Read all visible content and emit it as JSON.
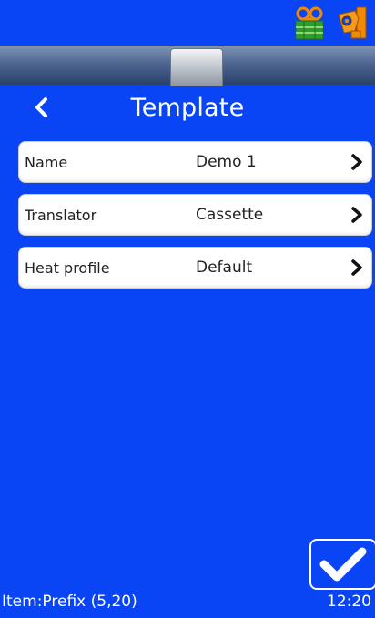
{
  "status_bar": {
    "icons": [
      "cassette-icon",
      "printhead-icon"
    ]
  },
  "nav": {
    "back_icon": "chevron-left-icon",
    "title": "Template"
  },
  "settings": [
    {
      "label": "Name",
      "value": "Demo 1"
    },
    {
      "label": "Translator",
      "value": "Cassette"
    },
    {
      "label": "Heat profile",
      "value": "Default"
    }
  ],
  "footer": {
    "item_status": "Item:Prefix (5,20)",
    "time": "12:20",
    "confirm_icon": "checkmark-icon"
  },
  "colors": {
    "background": "#0a45f5",
    "row_background": "#ffffff",
    "accent_icon": "#f28a00",
    "cassette_icon_green": "#2e9d2e"
  }
}
